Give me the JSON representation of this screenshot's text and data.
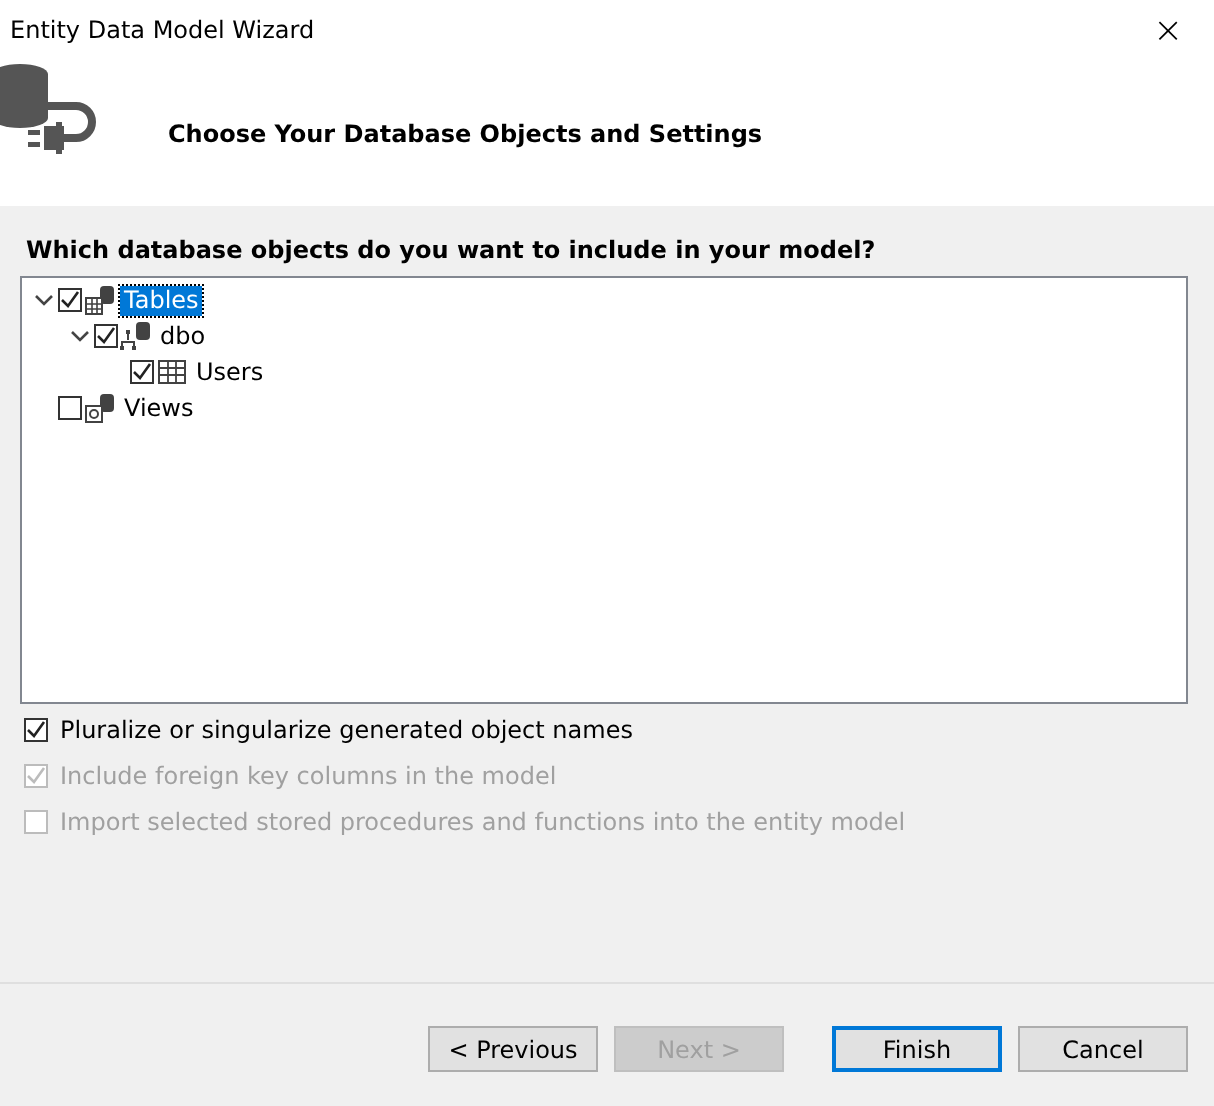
{
  "window": {
    "title": "Entity Data Model Wizard",
    "close": "×"
  },
  "header": {
    "title": "Choose Your Database Objects and Settings"
  },
  "tree": {
    "label": "Which database objects do you want to include in your model?",
    "items": [
      {
        "label": "Tables",
        "kind": "tables",
        "checked": true,
        "expanded": true,
        "selected": true,
        "children": [
          {
            "label": "dbo",
            "kind": "schema",
            "checked": true,
            "expanded": true,
            "selected": false,
            "children": [
              {
                "label": "Users",
                "kind": "table",
                "checked": true,
                "selected": false
              }
            ]
          }
        ]
      },
      {
        "label": "Views",
        "kind": "views",
        "checked": false,
        "selected": false
      }
    ]
  },
  "options": [
    {
      "label": "Pluralize or singularize generated object names",
      "checked": true,
      "disabled": false
    },
    {
      "label": "Include foreign key columns in the model",
      "checked": true,
      "disabled": true
    },
    {
      "label": "Import selected stored procedures and functions into the entity model",
      "checked": false,
      "disabled": true
    }
  ],
  "buttons": [
    {
      "label": "< Previous",
      "disabled": false,
      "default": false
    },
    {
      "label": "Next >",
      "disabled": true,
      "default": false
    },
    {
      "label": "Finish",
      "disabled": false,
      "default": true
    },
    {
      "label": "Cancel",
      "disabled": false,
      "default": false
    }
  ]
}
